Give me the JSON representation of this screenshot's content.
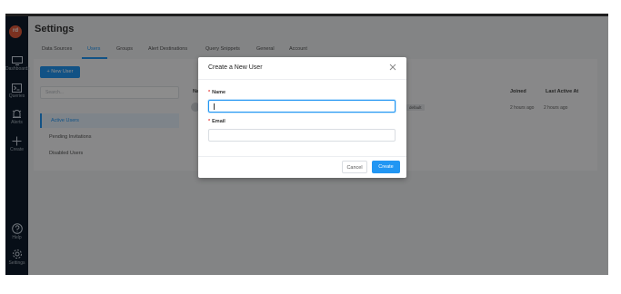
{
  "app": {
    "page_title": "Settings",
    "logo_text": "rd"
  },
  "sidebar": {
    "items": [
      {
        "label": "Dashboards",
        "icon": "monitor-icon"
      },
      {
        "label": "Queries",
        "icon": "terminal-icon"
      },
      {
        "label": "Alerts",
        "icon": "alarm-icon"
      },
      {
        "label": "Create",
        "icon": "plus-icon"
      },
      {
        "label": "Help",
        "icon": "question-icon"
      },
      {
        "label": "Settings",
        "icon": "gear-icon"
      }
    ]
  },
  "tabs": [
    "Data Sources",
    "Users",
    "Groups",
    "Alert Destinations",
    "Query Snippets",
    "General",
    "Account"
  ],
  "active_tab": "Users",
  "users": {
    "new_user_button": "+ New User",
    "search_placeholder": "Search...",
    "filters": [
      "Active Users",
      "Pending Invitations",
      "Disabled Users"
    ],
    "active_filter": "Active Users",
    "columns": {
      "name": "Nam",
      "joined": "Joined",
      "last_active": "Last Active At"
    },
    "row": {
      "badge": "default",
      "joined": "2 hours ago",
      "last_active": "2 hours ago"
    }
  },
  "modal": {
    "title": "Create a New User",
    "name_label": "Name",
    "name_value": "",
    "email_label": "Email",
    "email_value": "",
    "required_mark": "*",
    "cancel_label": "Cancel",
    "create_label": "Create"
  },
  "colors": {
    "accent": "#2196f3",
    "sidebar": "#0d1b2a",
    "logo": "#e05a3b",
    "required": "#e53935"
  }
}
